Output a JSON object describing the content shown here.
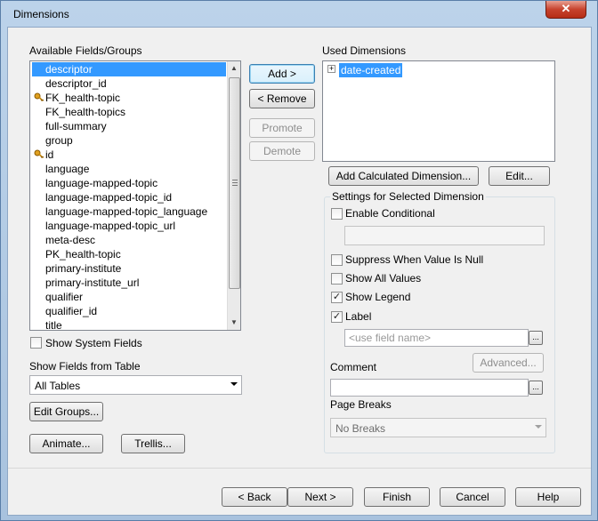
{
  "window": {
    "title": "Dimensions",
    "close_glyph": "✕"
  },
  "available": {
    "label": "Available Fields/Groups",
    "items": [
      {
        "label": "descriptor",
        "key": false,
        "selected": true
      },
      {
        "label": "descriptor_id",
        "key": false
      },
      {
        "label": "FK_health-topic",
        "key": true
      },
      {
        "label": "FK_health-topics",
        "key": false
      },
      {
        "label": "full-summary",
        "key": false
      },
      {
        "label": "group",
        "key": false
      },
      {
        "label": "id",
        "key": true
      },
      {
        "label": "language",
        "key": false
      },
      {
        "label": "language-mapped-topic",
        "key": false
      },
      {
        "label": "language-mapped-topic_id",
        "key": false
      },
      {
        "label": "language-mapped-topic_language",
        "key": false
      },
      {
        "label": "language-mapped-topic_url",
        "key": false
      },
      {
        "label": "meta-desc",
        "key": false
      },
      {
        "label": "PK_health-topic",
        "key": false
      },
      {
        "label": "primary-institute",
        "key": false
      },
      {
        "label": "primary-institute_url",
        "key": false
      },
      {
        "label": "qualifier",
        "key": false
      },
      {
        "label": "qualifier_id",
        "key": false
      },
      {
        "label": "title",
        "key": false
      }
    ],
    "show_system_fields": "Show System Fields",
    "show_fields_from_table": "Show Fields from Table",
    "table_value": "All Tables",
    "edit_groups": "Edit Groups...",
    "animate": "Animate...",
    "trellis": "Trellis..."
  },
  "middle": {
    "add": "Add >",
    "remove": "< Remove",
    "promote": "Promote",
    "demote": "Demote"
  },
  "used": {
    "label": "Used Dimensions",
    "expander": "+",
    "items": [
      "date-created"
    ],
    "add_calculated": "Add Calculated Dimension...",
    "edit": "Edit..."
  },
  "settings": {
    "group_label": "Settings for Selected Dimension",
    "enable_conditional": "Enable Conditional",
    "enable_conditional_checked": false,
    "suppress_null": "Suppress When Value Is Null",
    "suppress_null_checked": false,
    "show_all_values": "Show All Values",
    "show_all_values_checked": false,
    "show_legend": "Show Legend",
    "show_legend_checked": true,
    "label": "Label",
    "label_checked": true,
    "label_placeholder": "<use field name>",
    "advanced": "Advanced...",
    "comment": "Comment",
    "page_breaks": "Page Breaks",
    "page_breaks_value": "No Breaks",
    "check_glyph": "✓",
    "ellipsis": "..."
  },
  "footer": {
    "back": "< Back",
    "next": "Next >",
    "finish": "Finish",
    "cancel": "Cancel",
    "help": "Help"
  }
}
